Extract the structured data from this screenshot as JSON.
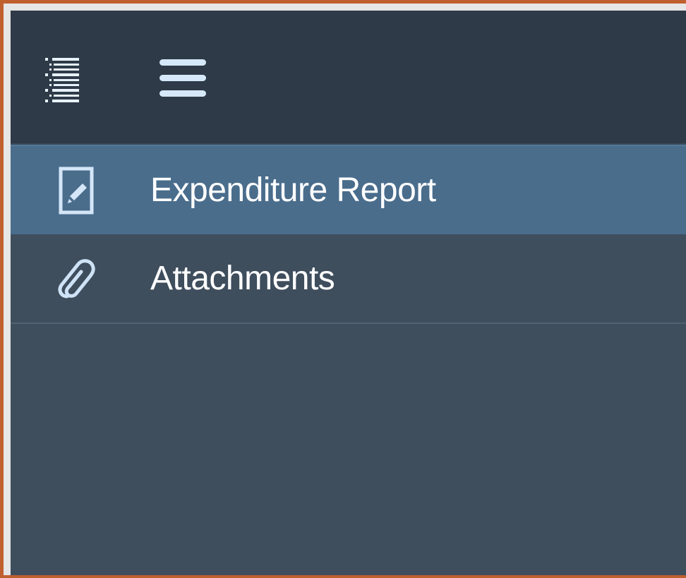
{
  "toolbar": {
    "outline_icon": "outline-list-icon",
    "menu_icon": "hamburger-menu-icon"
  },
  "nav": {
    "items": [
      {
        "label": "Expenditure Report",
        "icon": "edit-document-icon",
        "selected": true
      },
      {
        "label": "Attachments",
        "icon": "paperclip-icon",
        "selected": false
      }
    ]
  },
  "colors": {
    "toolbar_bg": "#2e3a47",
    "panel_bg": "#3f4e5d",
    "selected_bg": "#4a6d8c",
    "icon_color": "#cfe3f7",
    "frame_border": "#c0602f"
  }
}
